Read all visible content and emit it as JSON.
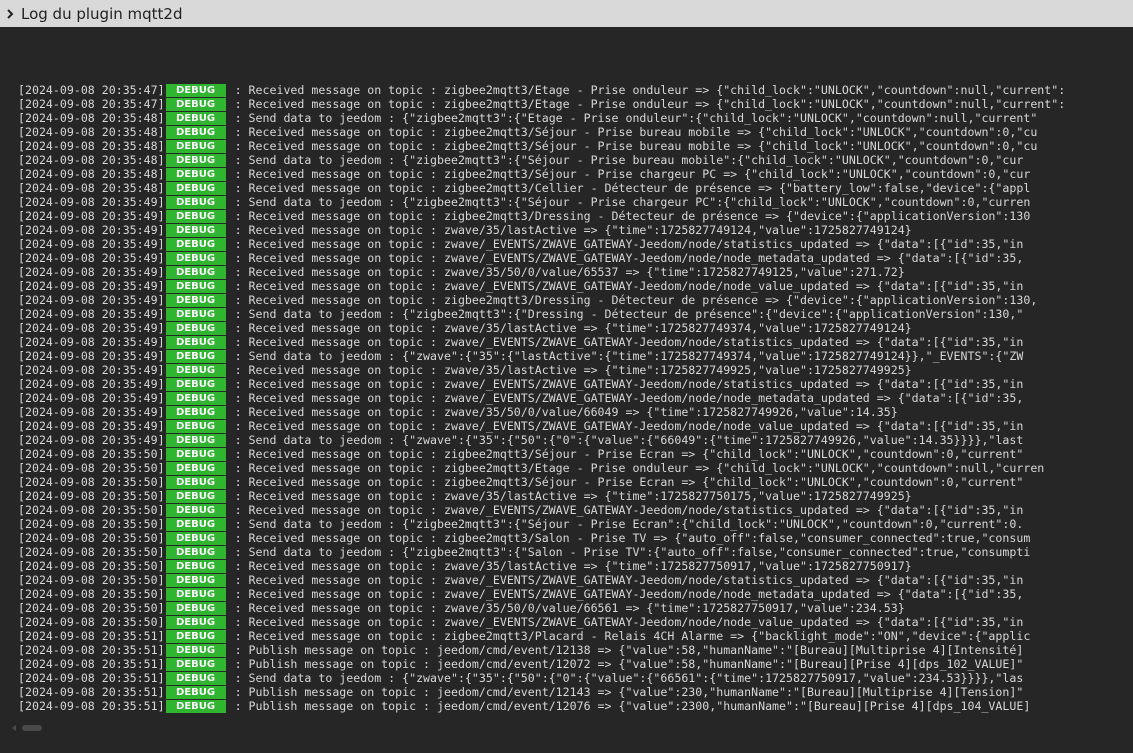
{
  "header": {
    "title": "Log du plugin mqtt2d",
    "icon": "chevron-right-icon"
  },
  "colors": {
    "debug_badge": "#2fb52f",
    "background": "#262626",
    "header_bg": "#d9d9d9"
  },
  "log": [
    {
      "ts": "[2024-09-08 20:35:47]",
      "level": "DEBUG",
      "msg": ": Received message on topic : zigbee2mqtt3/Etage - Prise onduleur => {\"child_lock\":\"UNLOCK\",\"countdown\":null,\"current\":"
    },
    {
      "ts": "[2024-09-08 20:35:47]",
      "level": "DEBUG",
      "msg": ": Received message on topic : zigbee2mqtt3/Etage - Prise onduleur => {\"child_lock\":\"UNLOCK\",\"countdown\":null,\"current\":"
    },
    {
      "ts": "[2024-09-08 20:35:48]",
      "level": "DEBUG",
      "msg": ": Send data to jeedom : {\"zigbee2mqtt3\":{\"Etage - Prise onduleur\":{\"child_lock\":\"UNLOCK\",\"countdown\":null,\"current\""
    },
    {
      "ts": "[2024-09-08 20:35:48]",
      "level": "DEBUG",
      "msg": ": Received message on topic : zigbee2mqtt3/Séjour - Prise bureau mobile => {\"child_lock\":\"UNLOCK\",\"countdown\":0,\"cu"
    },
    {
      "ts": "[2024-09-08 20:35:48]",
      "level": "DEBUG",
      "msg": ": Received message on topic : zigbee2mqtt3/Séjour - Prise bureau mobile => {\"child_lock\":\"UNLOCK\",\"countdown\":0,\"cu"
    },
    {
      "ts": "[2024-09-08 20:35:48]",
      "level": "DEBUG",
      "msg": ": Send data to jeedom : {\"zigbee2mqtt3\":{\"Séjour - Prise bureau mobile\":{\"child_lock\":\"UNLOCK\",\"countdown\":0,\"cur"
    },
    {
      "ts": "[2024-09-08 20:35:48]",
      "level": "DEBUG",
      "msg": ": Received message on topic : zigbee2mqtt3/Séjour - Prise chargeur PC => {\"child_lock\":\"UNLOCK\",\"countdown\":0,\"cur"
    },
    {
      "ts": "[2024-09-08 20:35:48]",
      "level": "DEBUG",
      "msg": ": Received message on topic : zigbee2mqtt3/Cellier - Détecteur de présence => {\"battery_low\":false,\"device\":{\"appl"
    },
    {
      "ts": "[2024-09-08 20:35:49]",
      "level": "DEBUG",
      "msg": ": Send data to jeedom : {\"zigbee2mqtt3\":{\"Séjour - Prise chargeur PC\":{\"child_lock\":\"UNLOCK\",\"countdown\":0,\"curren"
    },
    {
      "ts": "[2024-09-08 20:35:49]",
      "level": "DEBUG",
      "msg": ": Received message on topic : zigbee2mqtt3/Dressing - Détecteur de présence => {\"device\":{\"applicationVersion\":130"
    },
    {
      "ts": "[2024-09-08 20:35:49]",
      "level": "DEBUG",
      "msg": ": Received message on topic : zwave/35/lastActive => {\"time\":1725827749124,\"value\":1725827749124}"
    },
    {
      "ts": "[2024-09-08 20:35:49]",
      "level": "DEBUG",
      "msg": ": Received message on topic : zwave/_EVENTS/ZWAVE_GATEWAY-Jeedom/node/statistics_updated => {\"data\":[{\"id\":35,\"in"
    },
    {
      "ts": "[2024-09-08 20:35:49]",
      "level": "DEBUG",
      "msg": ": Received message on topic : zwave/_EVENTS/ZWAVE_GATEWAY-Jeedom/node/node_metadata_updated => {\"data\":[{\"id\":35,"
    },
    {
      "ts": "[2024-09-08 20:35:49]",
      "level": "DEBUG",
      "msg": ": Received message on topic : zwave/35/50/0/value/65537 => {\"time\":1725827749125,\"value\":271.72}"
    },
    {
      "ts": "[2024-09-08 20:35:49]",
      "level": "DEBUG",
      "msg": ": Received message on topic : zwave/_EVENTS/ZWAVE_GATEWAY-Jeedom/node/node_value_updated => {\"data\":[{\"id\":35,\"in"
    },
    {
      "ts": "[2024-09-08 20:35:49]",
      "level": "DEBUG",
      "msg": ": Received message on topic : zigbee2mqtt3/Dressing - Détecteur de présence => {\"device\":{\"applicationVersion\":130,"
    },
    {
      "ts": "[2024-09-08 20:35:49]",
      "level": "DEBUG",
      "msg": ": Send data to jeedom : {\"zigbee2mqtt3\":{\"Dressing - Détecteur de présence\":{\"device\":{\"applicationVersion\":130,\""
    },
    {
      "ts": "[2024-09-08 20:35:49]",
      "level": "DEBUG",
      "msg": ": Received message on topic : zwave/35/lastActive => {\"time\":1725827749374,\"value\":1725827749124}"
    },
    {
      "ts": "[2024-09-08 20:35:49]",
      "level": "DEBUG",
      "msg": ": Received message on topic : zwave/_EVENTS/ZWAVE_GATEWAY-Jeedom/node/statistics_updated => {\"data\":[{\"id\":35,\"in"
    },
    {
      "ts": "[2024-09-08 20:35:49]",
      "level": "DEBUG",
      "msg": ": Send data to jeedom : {\"zwave\":{\"35\":{\"lastActive\":{\"time\":1725827749374,\"value\":1725827749124}},\"_EVENTS\":{\"ZW"
    },
    {
      "ts": "[2024-09-08 20:35:49]",
      "level": "DEBUG",
      "msg": ": Received message on topic : zwave/35/lastActive => {\"time\":1725827749925,\"value\":1725827749925}"
    },
    {
      "ts": "[2024-09-08 20:35:49]",
      "level": "DEBUG",
      "msg": ": Received message on topic : zwave/_EVENTS/ZWAVE_GATEWAY-Jeedom/node/statistics_updated => {\"data\":[{\"id\":35,\"in"
    },
    {
      "ts": "[2024-09-08 20:35:49]",
      "level": "DEBUG",
      "msg": ": Received message on topic : zwave/_EVENTS/ZWAVE_GATEWAY-Jeedom/node/node_metadata_updated => {\"data\":[{\"id\":35,"
    },
    {
      "ts": "[2024-09-08 20:35:49]",
      "level": "DEBUG",
      "msg": ": Received message on topic : zwave/35/50/0/value/66049 => {\"time\":1725827749926,\"value\":14.35}"
    },
    {
      "ts": "[2024-09-08 20:35:49]",
      "level": "DEBUG",
      "msg": ": Received message on topic : zwave/_EVENTS/ZWAVE_GATEWAY-Jeedom/node/node_value_updated => {\"data\":[{\"id\":35,\"in"
    },
    {
      "ts": "[2024-09-08 20:35:49]",
      "level": "DEBUG",
      "msg": ": Send data to jeedom : {\"zwave\":{\"35\":{\"50\":{\"0\":{\"value\":{\"66049\":{\"time\":1725827749926,\"value\":14.35}}}},\"last"
    },
    {
      "ts": "[2024-09-08 20:35:50]",
      "level": "DEBUG",
      "msg": ": Received message on topic : zigbee2mqtt3/Séjour - Prise Ecran => {\"child_lock\":\"UNLOCK\",\"countdown\":0,\"current\""
    },
    {
      "ts": "[2024-09-08 20:35:50]",
      "level": "DEBUG",
      "msg": ": Received message on topic : zigbee2mqtt3/Etage - Prise onduleur => {\"child_lock\":\"UNLOCK\",\"countdown\":null,\"curren"
    },
    {
      "ts": "[2024-09-08 20:35:50]",
      "level": "DEBUG",
      "msg": ": Received message on topic : zigbee2mqtt3/Séjour - Prise Ecran => {\"child_lock\":\"UNLOCK\",\"countdown\":0,\"current\""
    },
    {
      "ts": "[2024-09-08 20:35:50]",
      "level": "DEBUG",
      "msg": ": Received message on topic : zwave/35/lastActive => {\"time\":1725827750175,\"value\":1725827749925}"
    },
    {
      "ts": "[2024-09-08 20:35:50]",
      "level": "DEBUG",
      "msg": ": Received message on topic : zwave/_EVENTS/ZWAVE_GATEWAY-Jeedom/node/statistics_updated => {\"data\":[{\"id\":35,\"in"
    },
    {
      "ts": "[2024-09-08 20:35:50]",
      "level": "DEBUG",
      "msg": ": Send data to jeedom : {\"zigbee2mqtt3\":{\"Séjour - Prise Ecran\":{\"child_lock\":\"UNLOCK\",\"countdown\":0,\"current\":0."
    },
    {
      "ts": "[2024-09-08 20:35:50]",
      "level": "DEBUG",
      "msg": ": Received message on topic : zigbee2mqtt3/Salon - Prise TV => {\"auto_off\":false,\"consumer_connected\":true,\"consum"
    },
    {
      "ts": "[2024-09-08 20:35:50]",
      "level": "DEBUG",
      "msg": ": Send data to jeedom : {\"zigbee2mqtt3\":{\"Salon - Prise TV\":{\"auto_off\":false,\"consumer_connected\":true,\"consumpti"
    },
    {
      "ts": "[2024-09-08 20:35:50]",
      "level": "DEBUG",
      "msg": ": Received message on topic : zwave/35/lastActive => {\"time\":1725827750917,\"value\":1725827750917}"
    },
    {
      "ts": "[2024-09-08 20:35:50]",
      "level": "DEBUG",
      "msg": ": Received message on topic : zwave/_EVENTS/ZWAVE_GATEWAY-Jeedom/node/statistics_updated => {\"data\":[{\"id\":35,\"in"
    },
    {
      "ts": "[2024-09-08 20:35:50]",
      "level": "DEBUG",
      "msg": ": Received message on topic : zwave/_EVENTS/ZWAVE_GATEWAY-Jeedom/node/node_metadata_updated => {\"data\":[{\"id\":35,"
    },
    {
      "ts": "[2024-09-08 20:35:50]",
      "level": "DEBUG",
      "msg": ": Received message on topic : zwave/35/50/0/value/66561 => {\"time\":1725827750917,\"value\":234.53}"
    },
    {
      "ts": "[2024-09-08 20:35:50]",
      "level": "DEBUG",
      "msg": ": Received message on topic : zwave/_EVENTS/ZWAVE_GATEWAY-Jeedom/node/node_value_updated => {\"data\":[{\"id\":35,\"in"
    },
    {
      "ts": "[2024-09-08 20:35:51]",
      "level": "DEBUG",
      "msg": ": Received message on topic : zigbee2mqtt3/Placard - Relais 4CH Alarme => {\"backlight_mode\":\"ON\",\"device\":{\"applic"
    },
    {
      "ts": "[2024-09-08 20:35:51]",
      "level": "DEBUG",
      "msg": ": Publish message on topic : jeedom/cmd/event/12138 => {\"value\":58,\"humanName\":\"[Bureau][Multiprise 4][Intensité]"
    },
    {
      "ts": "[2024-09-08 20:35:51]",
      "level": "DEBUG",
      "msg": ": Publish message on topic : jeedom/cmd/event/12072 => {\"value\":58,\"humanName\":\"[Bureau][Prise 4][dps_102_VALUE]\""
    },
    {
      "ts": "[2024-09-08 20:35:51]",
      "level": "DEBUG",
      "msg": ": Send data to jeedom : {\"zwave\":{\"35\":{\"50\":{\"0\":{\"value\":{\"66561\":{\"time\":1725827750917,\"value\":234.53}}}},\"las"
    },
    {
      "ts": "[2024-09-08 20:35:51]",
      "level": "DEBUG",
      "msg": ": Publish message on topic : jeedom/cmd/event/12143 => {\"value\":230,\"humanName\":\"[Bureau][Multiprise 4][Tension]\""
    },
    {
      "ts": "[2024-09-08 20:35:51]",
      "level": "DEBUG",
      "msg": ": Publish message on topic : jeedom/cmd/event/12076 => {\"value\":2300,\"humanName\":\"[Bureau][Prise 4][dps_104_VALUE]"
    }
  ]
}
